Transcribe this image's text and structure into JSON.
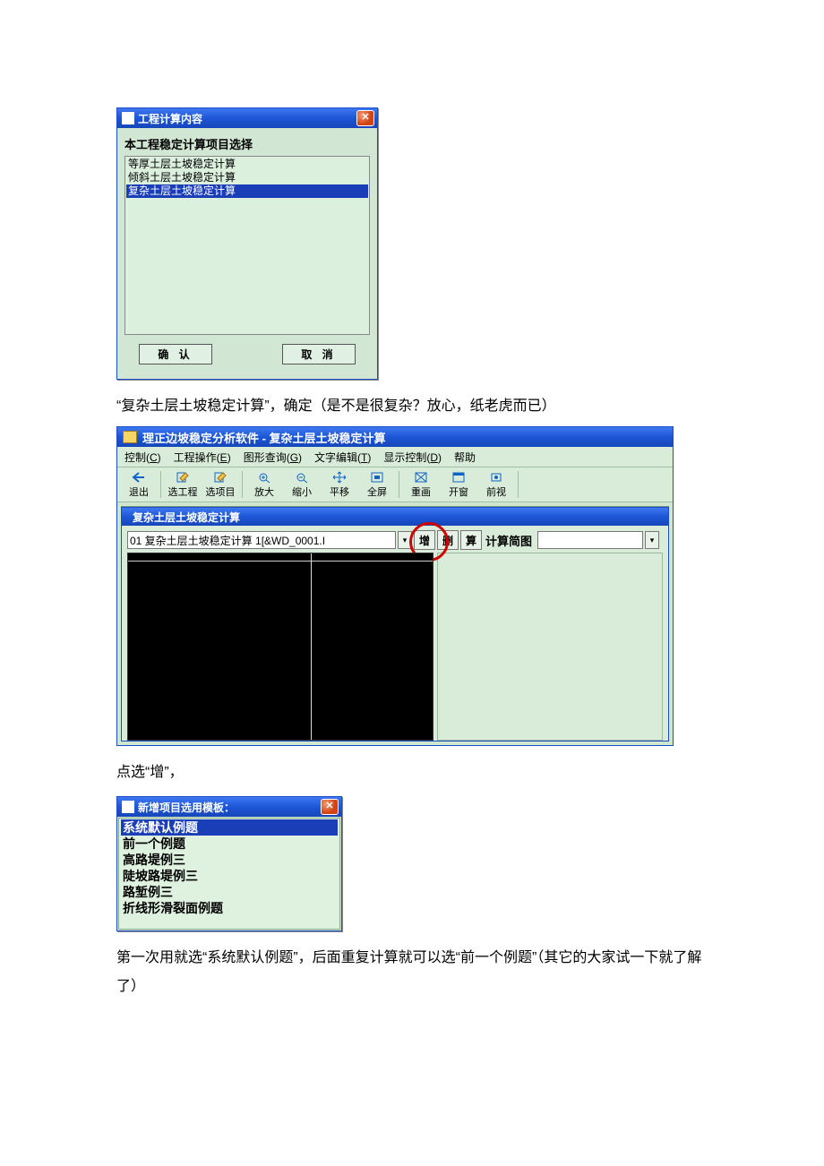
{
  "dialog1": {
    "title": "工程计算内容",
    "label": "本工程稳定计算项目选择",
    "items": [
      "等厚土层土坡稳定计算",
      "倾斜土层土坡稳定计算",
      "复杂土层土坡稳定计算"
    ],
    "selected_index": 2,
    "ok": "确 认",
    "cancel": "取 消"
  },
  "para1": "“复杂土层土坡稳定计算”，确定（是不是很复杂？放心，纸老虎而已）",
  "app": {
    "title": "理正边坡稳定分析软件 - 复杂土层土坡稳定计算",
    "menus": {
      "m1": "控制(C)",
      "m1u": "C",
      "m2": "工程操作(E)",
      "m2u": "E",
      "m3": "图形查询(G)",
      "m3u": "G",
      "m4": "文字编辑(T)",
      "m4u": "T",
      "m5": "显示控制(D)",
      "m5u": "D",
      "m6": "帮助"
    },
    "tools": {
      "t1": "退出",
      "t2": "选工程",
      "t3": "选项目",
      "t4": "放大",
      "t5": "缩小",
      "t6": "平移",
      "t7": "全屏",
      "t8": "重画",
      "t9": "开窗",
      "t10": "前视"
    },
    "child_title": "复杂土层土坡稳定计算",
    "combo1_value": "01 复杂土层土坡稳定计算 1[&WD_0001.I",
    "btn_add": "增",
    "btn_del": "删",
    "btn_calc": "算",
    "label_right": "计算简图"
  },
  "para2": "点选“增”，",
  "dialog3": {
    "title": "新增项目选用模板：",
    "items": [
      "系统默认例题",
      "前一个例题",
      "高路堤例三",
      "陡坡路堤例三",
      "路堑例三",
      "折线形滑裂面例题"
    ],
    "selected_index": 0
  },
  "para3": "第一次用就选“系统默认例题”，后面重复计算就可以选“前一个例题”（其它的大家试一下就了解了）"
}
